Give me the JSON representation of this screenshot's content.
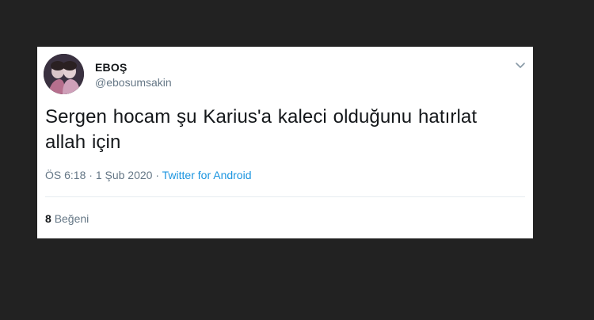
{
  "tweet": {
    "display_name": "EBOŞ",
    "handle": "@ebosumsakin",
    "text": "Sergen hocam şu Karius'a kaleci olduğunu hatırlat allah için",
    "time": "ÖS 6:18",
    "separator": "·",
    "date": "1 Şub 2020",
    "source": "Twitter for Android",
    "likes_count": "8",
    "likes_label": "Beğeni"
  },
  "icons": {
    "more": "chevron-down-icon",
    "avatar": "profile-photo"
  },
  "colors": {
    "background": "#222222",
    "card": "#ffffff",
    "text": "#14171a",
    "muted": "#657786",
    "link": "#1b95e0"
  }
}
